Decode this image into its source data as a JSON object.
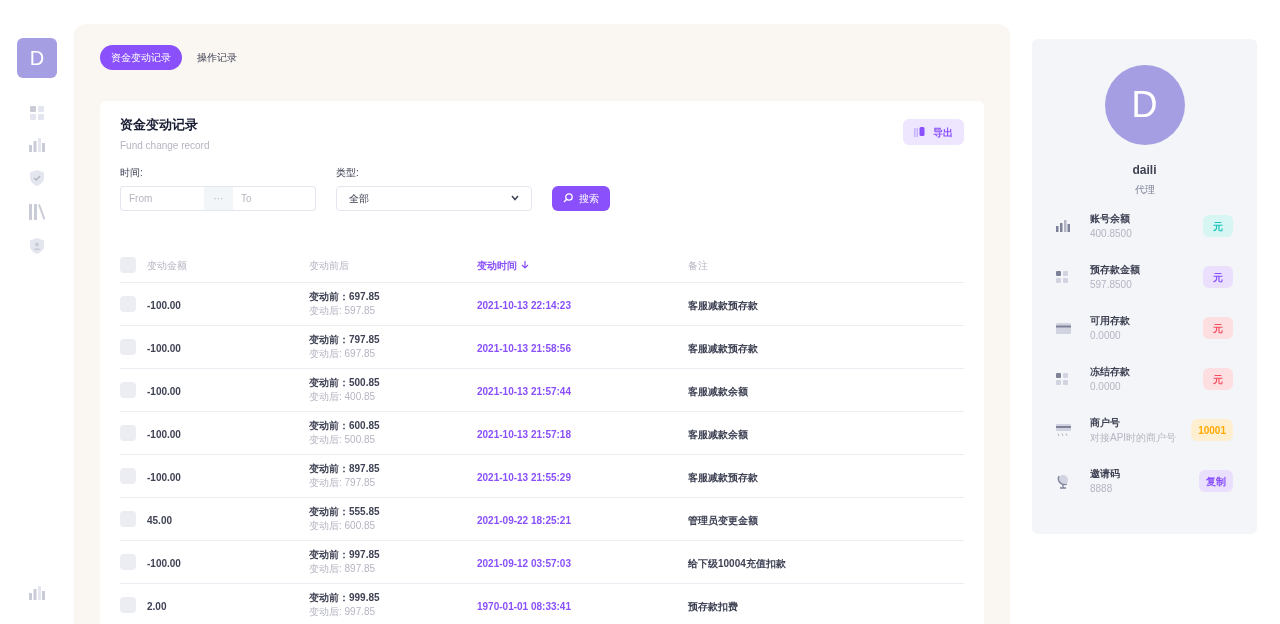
{
  "rail": {
    "avatar": "D"
  },
  "tabs": [
    {
      "label": "资金变动记录",
      "selected": true
    },
    {
      "label": "操作记录",
      "selected": false
    }
  ],
  "card": {
    "title": "资金变动记录",
    "subtitle": "Fund change record",
    "export_button": "导出"
  },
  "filters": {
    "time_label": "时间:",
    "from_placeholder": "From",
    "separator": "···",
    "to_placeholder": "To",
    "type_label": "类型:",
    "type_value": "全部",
    "search_button": "搜索"
  },
  "table": {
    "header_checked": false,
    "columns": [
      {
        "label": "变动金额",
        "sorted": false
      },
      {
        "label": "变动前后",
        "sorted": false
      },
      {
        "label": "变动时间",
        "sorted": true
      },
      {
        "label": "备注",
        "sorted": false
      }
    ],
    "rows": [
      {
        "checked": false,
        "amount": "-100.00",
        "before": "变动前：697.85",
        "after": "变动后: 597.85",
        "time": "2021-10-13 22:14:23",
        "note": "客服减款预存款"
      },
      {
        "checked": false,
        "amount": "-100.00",
        "before": "变动前：797.85",
        "after": "变动后: 697.85",
        "time": "2021-10-13 21:58:56",
        "note": "客服减款预存款"
      },
      {
        "checked": false,
        "amount": "-100.00",
        "before": "变动前：500.85",
        "after": "变动后: 400.85",
        "time": "2021-10-13 21:57:44",
        "note": "客服减款余额"
      },
      {
        "checked": false,
        "amount": "-100.00",
        "before": "变动前：600.85",
        "after": "变动后: 500.85",
        "time": "2021-10-13 21:57:18",
        "note": "客服减款余额"
      },
      {
        "checked": false,
        "amount": "-100.00",
        "before": "变动前：897.85",
        "after": "变动后: 797.85",
        "time": "2021-10-13 21:55:29",
        "note": "客服减款预存款"
      },
      {
        "checked": false,
        "amount": "45.00",
        "before": "变动前：555.85",
        "after": "变动后: 600.85",
        "time": "2021-09-22 18:25:21",
        "note": "管理员变更金额"
      },
      {
        "checked": false,
        "amount": "-100.00",
        "before": "变动前：997.85",
        "after": "变动后: 897.85",
        "time": "2021-09-12 03:57:03",
        "note": "给下级10004充值扣款"
      },
      {
        "checked": false,
        "amount": "2.00",
        "before": "变动前：999.85",
        "after": "变动后: 997.85",
        "time": "1970-01-01 08:33:41",
        "note": "预存款扣费"
      }
    ]
  },
  "profile": {
    "avatar": "D",
    "name": "daili",
    "role": "代理",
    "items": [
      {
        "kind": "chart",
        "title": "账号余额",
        "value": "400.8500",
        "badge": "元",
        "color": "#1bc5bd"
      },
      {
        "kind": "grid",
        "title": "预存款金额",
        "value": "597.8500",
        "badge": "元",
        "color": "#8950fc"
      },
      {
        "kind": "card",
        "title": "可用存款",
        "value": "0.0000",
        "badge": "元",
        "color": "#f64e60"
      },
      {
        "kind": "grid",
        "title": "冻结存款",
        "value": "0.0000",
        "badge": "元",
        "color": "#f64e60"
      },
      {
        "kind": "terminal",
        "title": "商户号",
        "value": "对接API时的商户号",
        "badge": "10001",
        "color": "#ffa800"
      },
      {
        "kind": "globe",
        "title": "邀请码",
        "value": "8888",
        "badge": "复制",
        "color": "#8950fc"
      }
    ]
  }
}
